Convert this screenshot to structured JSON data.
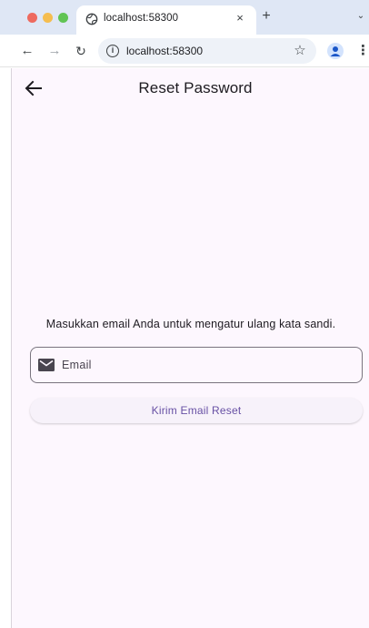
{
  "browser": {
    "tab": {
      "title": "localhost:58300",
      "close_glyph": "×"
    },
    "new_tab_glyph": "+",
    "tab_menu_glyph": "⌄",
    "nav": {
      "back_glyph": "←",
      "forward_glyph": "→",
      "reload_glyph": "↻"
    },
    "omnibox": {
      "url": "localhost:58300",
      "info_glyph": "i"
    },
    "bookmark_glyph": "☆",
    "menu_glyph": "⋮",
    "colors": {
      "tabstrip_bg": "#dfe7f5",
      "omnibox_bg": "#eef2f8"
    }
  },
  "app": {
    "title": "Reset Password",
    "instruction": "Masukkan email Anda untuk mengatur ulang kata sandi.",
    "email_field": {
      "label": "Email",
      "value": ""
    },
    "submit_label": "Kirim Email Reset",
    "colors": {
      "background": "#fdf7fe",
      "accent": "#6750a4",
      "outline": "#79747e"
    }
  }
}
